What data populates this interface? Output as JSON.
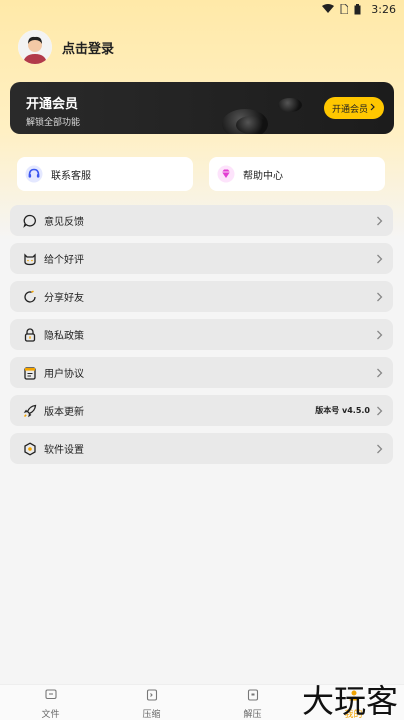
{
  "status_bar": {
    "time": "3:26",
    "icons": [
      "wifi-icon",
      "no-sim-icon",
      "battery-icon"
    ]
  },
  "profile": {
    "login_text": "点击登录",
    "avatar": "avatar"
  },
  "vip": {
    "title": "开通会员",
    "subtitle": "解锁全部功能",
    "button_label": "开通会员"
  },
  "quick_actions": [
    {
      "label": "联系客服",
      "icon": "headset-icon"
    },
    {
      "label": "帮助中心",
      "icon": "diamond-icon"
    }
  ],
  "menu": [
    {
      "label": "意见反馈",
      "icon": "chat-icon",
      "value": ""
    },
    {
      "label": "给个好评",
      "icon": "cat-icon",
      "value": ""
    },
    {
      "label": "分享好友",
      "icon": "refresh-icon",
      "value": ""
    },
    {
      "label": "隐私政策",
      "icon": "lock-icon",
      "value": ""
    },
    {
      "label": "用户协议",
      "icon": "note-icon",
      "value": ""
    },
    {
      "label": "版本更新",
      "icon": "rocket-icon",
      "value": "版本号 v4.5.0"
    },
    {
      "label": "软件设置",
      "icon": "hexagon-icon",
      "value": ""
    }
  ],
  "tabs": [
    {
      "label": "文件",
      "icon": "file-icon"
    },
    {
      "label": "压缩",
      "icon": "compress-icon"
    },
    {
      "label": "解压",
      "icon": "decompress-icon"
    },
    {
      "label": "我的",
      "icon": "user-icon"
    }
  ],
  "watermark": "大玩客",
  "colors": {
    "accent": "#ffc700",
    "vip_bg": "#1c1c1c",
    "menu_bg": "#e9e9e9"
  }
}
